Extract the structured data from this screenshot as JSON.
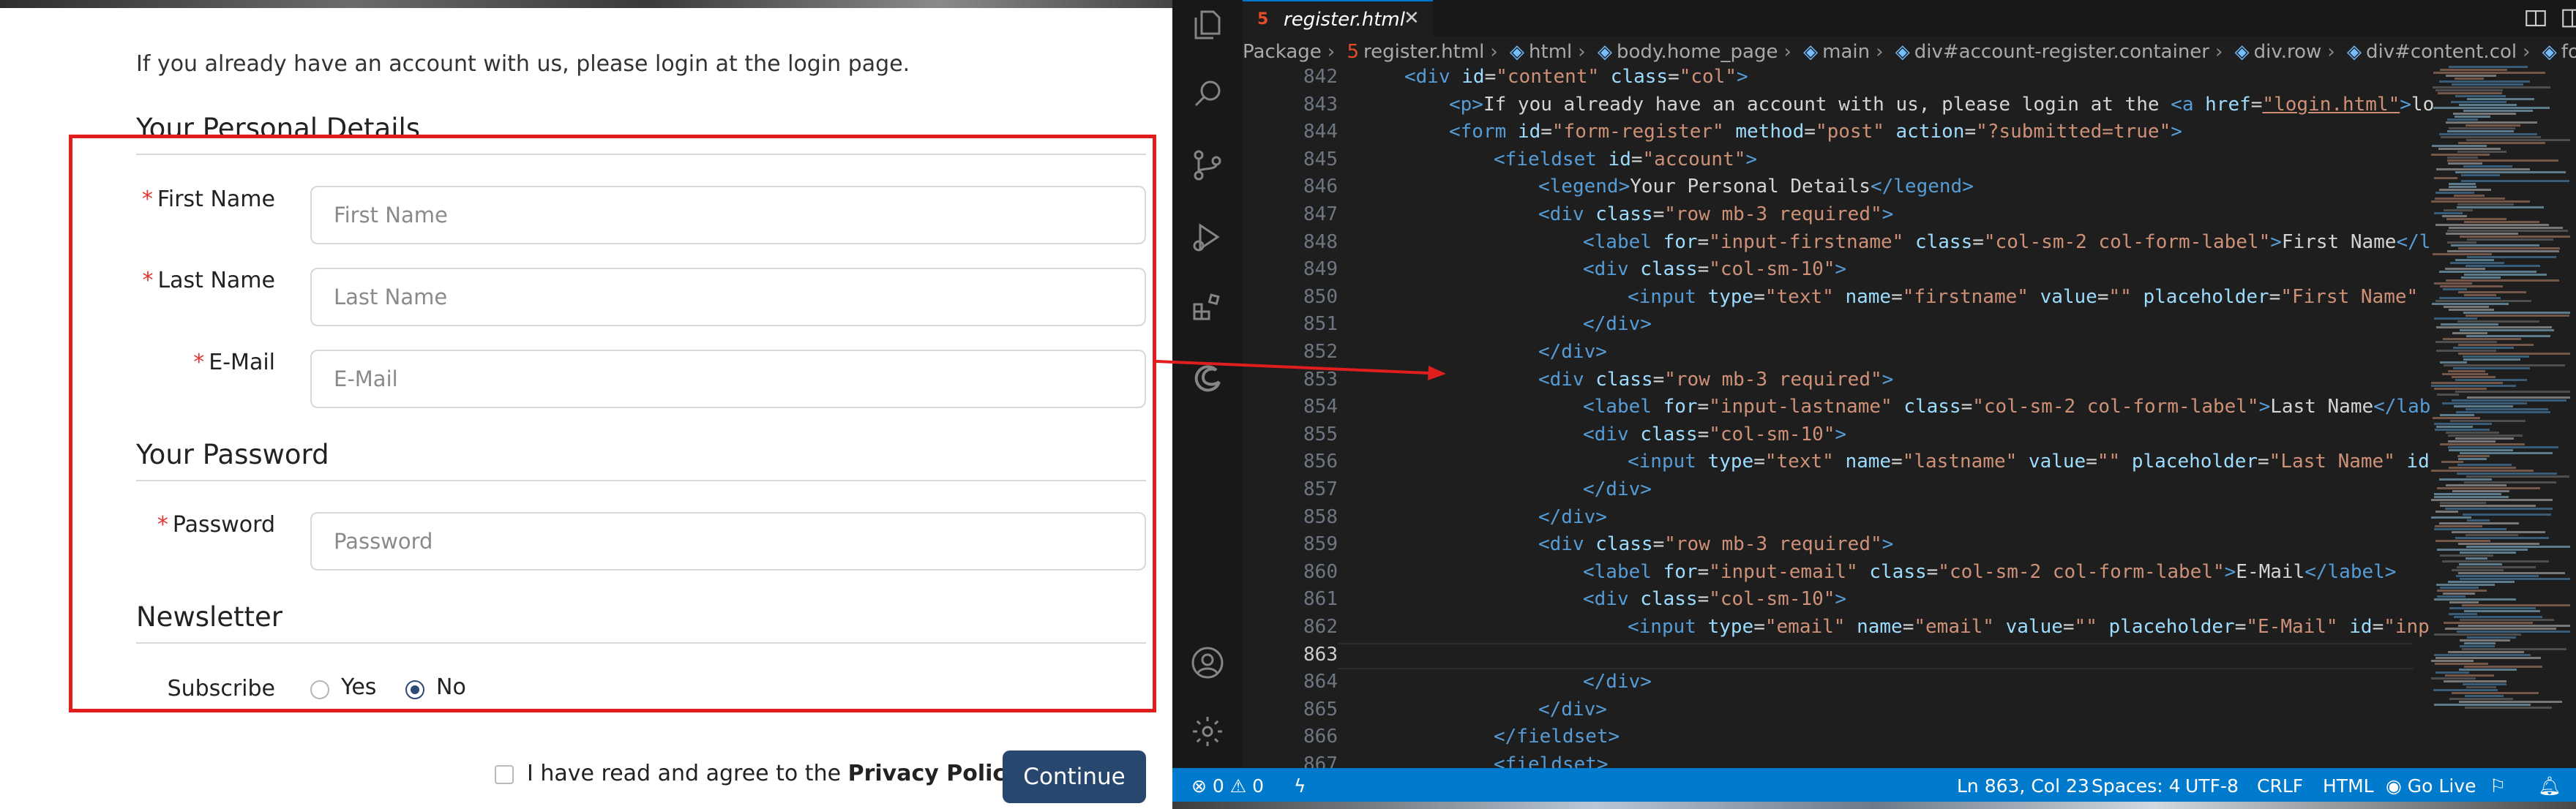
{
  "webpage": {
    "intro_text": "If you already have an account with us, please login at the login page.",
    "personal_legend": "Your Personal Details",
    "password_legend": "Your Password",
    "newsletter_legend": "Newsletter",
    "required_marker": "*",
    "fields": {
      "firstname": {
        "label": "First Name",
        "placeholder": "First Name",
        "value": ""
      },
      "lastname": {
        "label": "Last Name",
        "placeholder": "Last Name",
        "value": ""
      },
      "email": {
        "label": "E-Mail",
        "placeholder": "E-Mail",
        "value": ""
      },
      "password": {
        "label": "Password",
        "placeholder": "Password",
        "value": ""
      }
    },
    "subscribe": {
      "label": "Subscribe",
      "options": [
        "Yes",
        "No"
      ],
      "selected": "No"
    },
    "privacy_text": "I have read and agree to the ",
    "privacy_link": "Privacy Policy",
    "continue_label": "Continue",
    "annotation_color": "#e01e1e",
    "button_color": "#27476e"
  },
  "editor": {
    "tab_title": "register.html",
    "tab_icon": "html5-icon",
    "breadcrumb": [
      "Package",
      "register.html",
      "html",
      "body.home_page",
      "main",
      "div#account-register.container",
      "div.row",
      "div#content.col",
      "form#"
    ],
    "current_line": "863",
    "code_lines": [
      {
        "num": "842",
        "html": "<span class=\"t\">&lt;div</span> <span class=\"a\">id</span>=<span class=\"s\">\"content\"</span> <span class=\"a\">class</span>=<span class=\"s\">\"col\"</span><span class=\"t\">&gt;</span>",
        "indent": 1
      },
      {
        "num": "843",
        "html": "<span class=\"t\">&lt;p&gt;</span>If you already have an account with us, please login at the <span class=\"t\">&lt;a</span> <span class=\"a\">href</span>=<span class=\"u\">\"login.html\"</span><span class=\"t\">&gt;</span>lo",
        "indent": 2
      },
      {
        "num": "844",
        "html": "<span class=\"t\">&lt;form</span> <span class=\"a\">id</span>=<span class=\"s\">\"form-register\"</span> <span class=\"a\">method</span>=<span class=\"s\">\"post\"</span> <span class=\"a\">action</span>=<span class=\"s\">\"?submitted=true\"</span><span class=\"t\">&gt;</span>",
        "indent": 2
      },
      {
        "num": "845",
        "html": "<span class=\"t\">&lt;fieldset</span> <span class=\"a\">id</span>=<span class=\"s\">\"account\"</span><span class=\"t\">&gt;</span>",
        "indent": 3
      },
      {
        "num": "846",
        "html": "<span class=\"t\">&lt;legend&gt;</span>Your Personal Details<span class=\"t\">&lt;/legend&gt;</span>",
        "indent": 4
      },
      {
        "num": "847",
        "html": "<span class=\"t\">&lt;div</span> <span class=\"a\">class</span>=<span class=\"s\">\"row mb-3 required\"</span><span class=\"t\">&gt;</span>",
        "indent": 4
      },
      {
        "num": "848",
        "html": "<span class=\"t\">&lt;label</span> <span class=\"a\">for</span>=<span class=\"s\">\"input-firstname\"</span> <span class=\"a\">class</span>=<span class=\"s\">\"col-sm-2 col-form-label\"</span><span class=\"t\">&gt;</span>First Name<span class=\"t\">&lt;/l</span>",
        "indent": 5
      },
      {
        "num": "849",
        "html": "<span class=\"t\">&lt;div</span> <span class=\"a\">class</span>=<span class=\"s\">\"col-sm-10\"</span><span class=\"t\">&gt;</span>",
        "indent": 5
      },
      {
        "num": "850",
        "html": "<span class=\"t\">&lt;input</span> <span class=\"a\">type</span>=<span class=\"s\">\"text\"</span> <span class=\"a\">name</span>=<span class=\"s\">\"firstname\"</span> <span class=\"a\">value</span>=<span class=\"s\">\"\"</span> <span class=\"a\">placeholder</span>=<span class=\"s\">\"First Name\"</span>",
        "indent": 6
      },
      {
        "num": "851",
        "html": "<span class=\"t\">&lt;/div&gt;</span>",
        "indent": 5
      },
      {
        "num": "852",
        "html": "<span class=\"t\">&lt;/div&gt;</span>",
        "indent": 4
      },
      {
        "num": "853",
        "html": "<span class=\"t\">&lt;div</span> <span class=\"a\">class</span>=<span class=\"s\">\"row mb-3 required\"</span><span class=\"t\">&gt;</span>",
        "indent": 4
      },
      {
        "num": "854",
        "html": "<span class=\"t\">&lt;label</span> <span class=\"a\">for</span>=<span class=\"s\">\"input-lastname\"</span> <span class=\"a\">class</span>=<span class=\"s\">\"col-sm-2 col-form-label\"</span><span class=\"t\">&gt;</span>Last Name<span class=\"t\">&lt;/lab</span>",
        "indent": 5
      },
      {
        "num": "855",
        "html": "<span class=\"t\">&lt;div</span> <span class=\"a\">class</span>=<span class=\"s\">\"col-sm-10\"</span><span class=\"t\">&gt;</span>",
        "indent": 5
      },
      {
        "num": "856",
        "html": "<span class=\"t\">&lt;input</span> <span class=\"a\">type</span>=<span class=\"s\">\"text\"</span> <span class=\"a\">name</span>=<span class=\"s\">\"lastname\"</span> <span class=\"a\">value</span>=<span class=\"s\">\"\"</span> <span class=\"a\">placeholder</span>=<span class=\"s\">\"Last Name\"</span> <span class=\"a\">id</span>",
        "indent": 6
      },
      {
        "num": "857",
        "html": "<span class=\"t\">&lt;/div&gt;</span>",
        "indent": 5
      },
      {
        "num": "858",
        "html": "<span class=\"t\">&lt;/div&gt;</span>",
        "indent": 4
      },
      {
        "num": "859",
        "html": "<span class=\"t\">&lt;div</span> <span class=\"a\">class</span>=<span class=\"s\">\"row mb-3 required\"</span><span class=\"t\">&gt;</span>",
        "indent": 4
      },
      {
        "num": "860",
        "html": "<span class=\"t\">&lt;label</span> <span class=\"a\">for</span>=<span class=\"s\">\"input-email\"</span> <span class=\"a\">class</span>=<span class=\"s\">\"col-sm-2 col-form-label\"</span><span class=\"t\">&gt;</span>E-Mail<span class=\"t\">&lt;/label&gt;</span>",
        "indent": 5
      },
      {
        "num": "861",
        "html": "<span class=\"t\">&lt;div</span> <span class=\"a\">class</span>=<span class=\"s\">\"col-sm-10\"</span><span class=\"t\">&gt;</span>",
        "indent": 5
      },
      {
        "num": "862",
        "html": "<span class=\"t\">&lt;input</span> <span class=\"a\">type</span>=<span class=\"s\">\"email\"</span> <span class=\"a\">name</span>=<span class=\"s\">\"email\"</span> <span class=\"a\">value</span>=<span class=\"s\">\"\"</span> <span class=\"a\">placeholder</span>=<span class=\"s\">\"E-Mail\"</span> <span class=\"a\">id</span>=<span class=\"s\">\"inp</span>",
        "indent": 6
      },
      {
        "num": "863",
        "html": "",
        "indent": 5
      },
      {
        "num": "864",
        "html": "<span class=\"t\">&lt;/div&gt;</span>",
        "indent": 5
      },
      {
        "num": "865",
        "html": "<span class=\"t\">&lt;/div&gt;</span>",
        "indent": 4
      },
      {
        "num": "866",
        "html": "<span class=\"t\">&lt;/fieldset&gt;</span>",
        "indent": 3
      },
      {
        "num": "867",
        "html": "<span class=\"t\">&lt;fieldset&gt;</span>",
        "indent": 3
      }
    ],
    "status": {
      "errors": "0",
      "warnings": "0",
      "position": "Ln 863, Col 23",
      "spaces": "Spaces: 4",
      "encoding": "UTF-8",
      "eol": "CRLF",
      "language": "HTML",
      "live": "Go Live"
    },
    "theme_colors": {
      "background": "#1e1e1e",
      "status_bar": "#007acc",
      "tag": "#569cd6",
      "attribute": "#9cdcfe",
      "string": "#ce9178"
    }
  }
}
